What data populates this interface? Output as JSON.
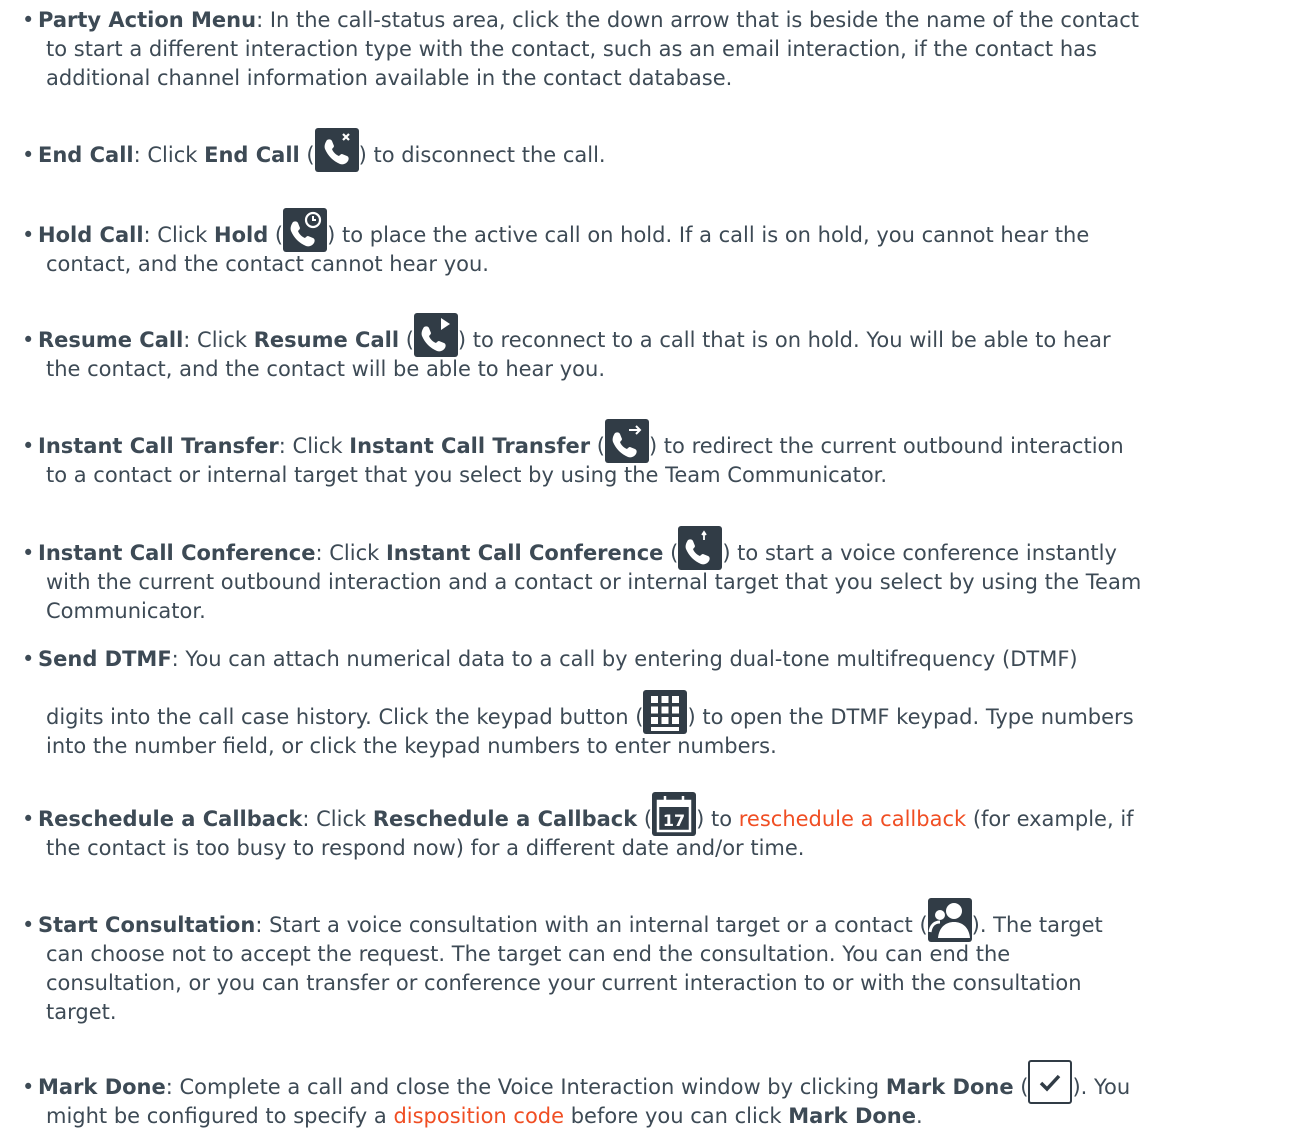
{
  "items": [
    {
      "key": "party",
      "title": "Party Action Menu",
      "lines": [
        ": In the call-status area, click the down arrow that is beside the name of the contact",
        "to start a different interaction type with the contact, such as an email interaction, if the contact has",
        "additional channel information available in the contact database."
      ]
    },
    {
      "key": "end",
      "title": "End Call",
      "pre": ": Click ",
      "button": "End Call",
      "icon": "end-call-icon",
      "post": ") to disconnect the call."
    },
    {
      "key": "hold",
      "title": "Hold Call",
      "pre": ": Click ",
      "button": "Hold",
      "icon": "hold-call-icon",
      "post": ") to place the active call on hold. If a call is on hold, you cannot hear the",
      "lines": [
        "contact, and the contact cannot hear you."
      ]
    },
    {
      "key": "resume",
      "title": "Resume Call",
      "pre": ": Click ",
      "button": "Resume Call",
      "icon": "resume-call-icon",
      "post": ") to reconnect to a call that is on hold. You will be able to hear",
      "lines": [
        "the contact, and the contact will be able to hear you."
      ]
    },
    {
      "key": "transfer",
      "title": "Instant Call Transfer",
      "pre": ": Click ",
      "button": "Instant Call Transfer",
      "icon": "call-transfer-icon",
      "post": ") to redirect the current outbound interaction",
      "lines": [
        "to a contact or internal target that you select by using the Team Communicator."
      ]
    },
    {
      "key": "conference",
      "title": "Instant Call Conference",
      "pre": ": Click ",
      "button": "Instant Call Conference",
      "icon": "call-conference-icon",
      "post": ") to start a voice conference instantly",
      "lines": [
        "with the current outbound interaction and a contact or internal target that you select by using the Team",
        "Communicator."
      ]
    },
    {
      "key": "dtmf",
      "title": "Send DTMF",
      "first": ": You can attach numerical data to a call by entering dual-tone multifrequency (DTMF)",
      "pre2": "digits into the call case history. Click the keypad button (",
      "icon": "keypad-icon",
      "post2": ") to open the DTMF keypad. Type numbers",
      "lines": [
        "into the number field, or click the keypad numbers to enter numbers."
      ]
    },
    {
      "key": "reschedule",
      "title": "Reschedule a Callback",
      "pre": ": Click ",
      "button": "Reschedule a Callback",
      "icon": "calendar-icon",
      "calendar_day": "17",
      "mid": ") to ",
      "link": "reschedule a callback",
      "post": " (for example, if",
      "lines": [
        "the contact is too busy to respond now) for a different date and/or time."
      ]
    },
    {
      "key": "consult",
      "title": "Start Consultation",
      "pre": ": Start a voice consultation with an internal target or a contact (",
      "icon": "consultation-icon",
      "post": "). The target",
      "lines": [
        "can choose not to accept the request. The target can end the consultation. You can end the",
        "consultation, or you can transfer or conference your current interaction to or with the consultation",
        "target."
      ]
    },
    {
      "key": "done",
      "title": "Mark Done",
      "pre": ": Complete a call and close the Voice Interaction window by clicking ",
      "button": "Mark Done",
      "icon": "checkmark-icon",
      "post": "). You",
      "l2pre": "might be configured to specify a ",
      "link": "disposition code",
      "l2mid": " before you can click ",
      "l2bold": "Mark Done",
      "l2post": "."
    }
  ],
  "bullet": "•",
  "open_paren": " ("
}
